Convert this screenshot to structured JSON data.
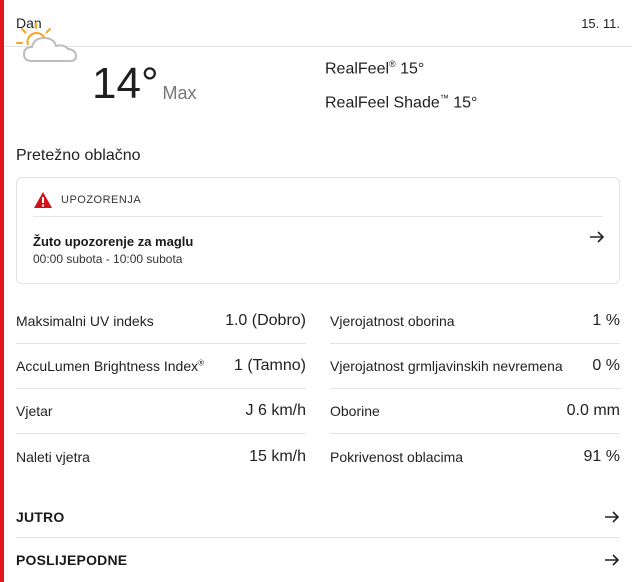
{
  "header": {
    "title": "Dan",
    "date": "15. 11."
  },
  "current": {
    "icon": "partly-cloudy-icon",
    "temperature": "14°",
    "temp_label": "Max",
    "realfeel": "RealFeel",
    "realfeel_value": " 15°",
    "realfeel_shade": "RealFeel Shade",
    "realfeel_shade_value": " 15°"
  },
  "phrase": "Pretežno oblačno",
  "alert": {
    "label": "UPOZORENJA",
    "title": "Žuto upozorenje za maglu",
    "time": "00:00 subota - 10:00 subota"
  },
  "details_left": [
    {
      "label": "Maksimalni UV indeks",
      "value": "1.0 (Dobro)"
    },
    {
      "label": "AccuLumen Brightness Index",
      "value": "1 (Tamno)"
    },
    {
      "label": "Vjetar",
      "value": "J 6 km/h"
    },
    {
      "label": "Naleti vjetra",
      "value": "15 km/h"
    }
  ],
  "details_right": [
    {
      "label": "Vjerojatnost oborina",
      "value": "1 %"
    },
    {
      "label": "Vjerojatnost grmljavinskih nevremena",
      "value": "0 %"
    },
    {
      "label": "Oborine",
      "value": "0.0 mm"
    },
    {
      "label": "Pokrivenost oblacima",
      "value": "91 %"
    }
  ],
  "sections": {
    "morning": "JUTRO",
    "afternoon": "POSLIJEPODNE"
  },
  "colors": {
    "accent": "#e1181b",
    "sun": "#f5a623",
    "cloud": "#c9c9c9"
  }
}
